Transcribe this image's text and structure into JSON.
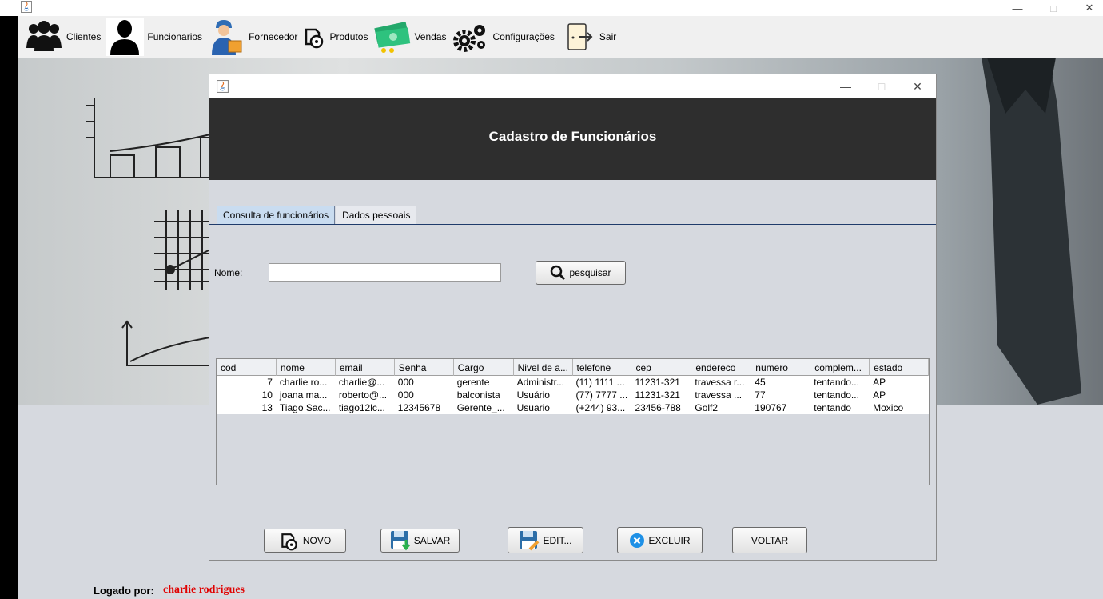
{
  "menu": [
    {
      "label": "Clientes",
      "icon": "people-icon"
    },
    {
      "label": "Funcionarios",
      "icon": "person-icon"
    },
    {
      "label": "Fornecedor",
      "icon": "delivery-man-icon"
    },
    {
      "label": "Produtos",
      "icon": "product-box-icon"
    },
    {
      "label": "Vendas",
      "icon": "money-icon"
    },
    {
      "label": "Configurações",
      "icon": "gears-icon"
    },
    {
      "label": "Sair",
      "icon": "exit-door-icon"
    }
  ],
  "dialog": {
    "header_title": "Cadastro de Funcionários",
    "tabs": [
      "Consulta de funcionários",
      "Dados pessoais"
    ],
    "search": {
      "label": "Nome:",
      "value": "",
      "button": "pesquisar"
    },
    "table": {
      "columns": [
        "cod",
        "nome",
        "email",
        "Senha",
        "Cargo",
        "Nivel de a...",
        "telefone",
        "cep",
        "endereco",
        "numero",
        "complem...",
        "estado"
      ],
      "rows": [
        [
          "7",
          "charlie ro...",
          "charlie@...",
          "000",
          "gerente",
          "Administr...",
          "(11) 1111 ...",
          "11231-321",
          "travessa r...",
          "45",
          "tentando...",
          "AP"
        ],
        [
          "10",
          "joana ma...",
          "roberto@...",
          "000",
          "balconista",
          "Usuário",
          "(77) 7777 ...",
          "11231-321",
          "travessa ...",
          "77",
          "tentando...",
          "AP"
        ],
        [
          "13",
          "Tiago Sac...",
          "tiago12lc...",
          "12345678",
          "Gerente_...",
          "Usuario",
          "(+244) 93...",
          "23456-788",
          "Golf2",
          "190767",
          "tentando",
          "Moxico"
        ]
      ]
    },
    "buttons": {
      "novo": "NOVO",
      "salvar": "SALVAR",
      "editar": "EDIT...",
      "excluir": "EXCLUIR",
      "voltar": "VOLTAR"
    }
  },
  "footer": {
    "logged_label": "Logado por:",
    "logged_user": "charlie rodrigues"
  },
  "colors": {
    "header_bg": "#2e2e2e",
    "logged_user": "#e00000",
    "excluir_icon": "#1e90e6"
  }
}
